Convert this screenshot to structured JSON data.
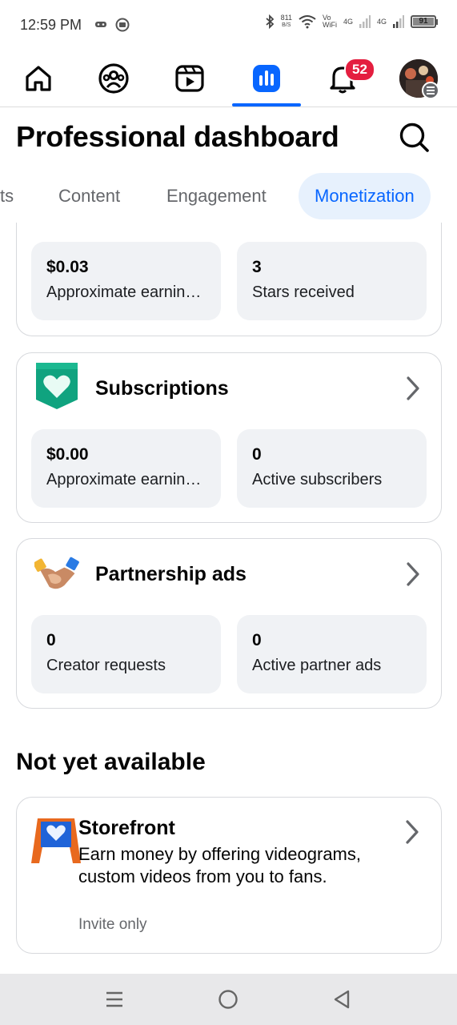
{
  "status_bar": {
    "time": "12:59 PM",
    "net_speed_top": "811",
    "net_speed_unit": "B/S",
    "vowifi_top": "Vo",
    "vowifi_bottom": "WiFi",
    "sim1": "4G",
    "sim2": "4G",
    "battery": "91"
  },
  "top_nav": {
    "items": [
      "home-icon",
      "groups-icon",
      "video-icon",
      "dashboard-icon",
      "notifications-icon",
      "profile-avatar"
    ],
    "active": "dashboard-icon",
    "notifications_count": "52"
  },
  "header": {
    "title": "Professional dashboard"
  },
  "tabs": [
    "ts",
    "Content",
    "Engagement",
    "Monetization"
  ],
  "active_tab": "Monetization",
  "stars_card": {
    "stats": [
      {
        "value": "$0.03",
        "label": "Approximate earnin…"
      },
      {
        "value": "3",
        "label": "Stars received"
      }
    ]
  },
  "subscriptions_card": {
    "title": "Subscriptions",
    "icon": "heart-shield-icon",
    "stats": [
      {
        "value": "$0.00",
        "label": "Approximate earnin…"
      },
      {
        "value": "0",
        "label": "Active subscribers"
      }
    ]
  },
  "partnership_card": {
    "title": "Partnership ads",
    "icon": "handshake-icon",
    "stats": [
      {
        "value": "0",
        "label": "Creator requests"
      },
      {
        "value": "0",
        "label": "Active partner ads"
      }
    ]
  },
  "not_available": {
    "title": "Not yet available",
    "storefront": {
      "title": "Storefront",
      "description": "Earn money by offering videograms, custom videos from you to fans.",
      "note": "Invite only",
      "icon": "storefront-sign-icon"
    }
  },
  "colors": {
    "accent": "#0866ff",
    "badge": "#e41e3f",
    "card_bg": "#f0f2f5",
    "tab_active_bg": "#e7f1fd"
  }
}
